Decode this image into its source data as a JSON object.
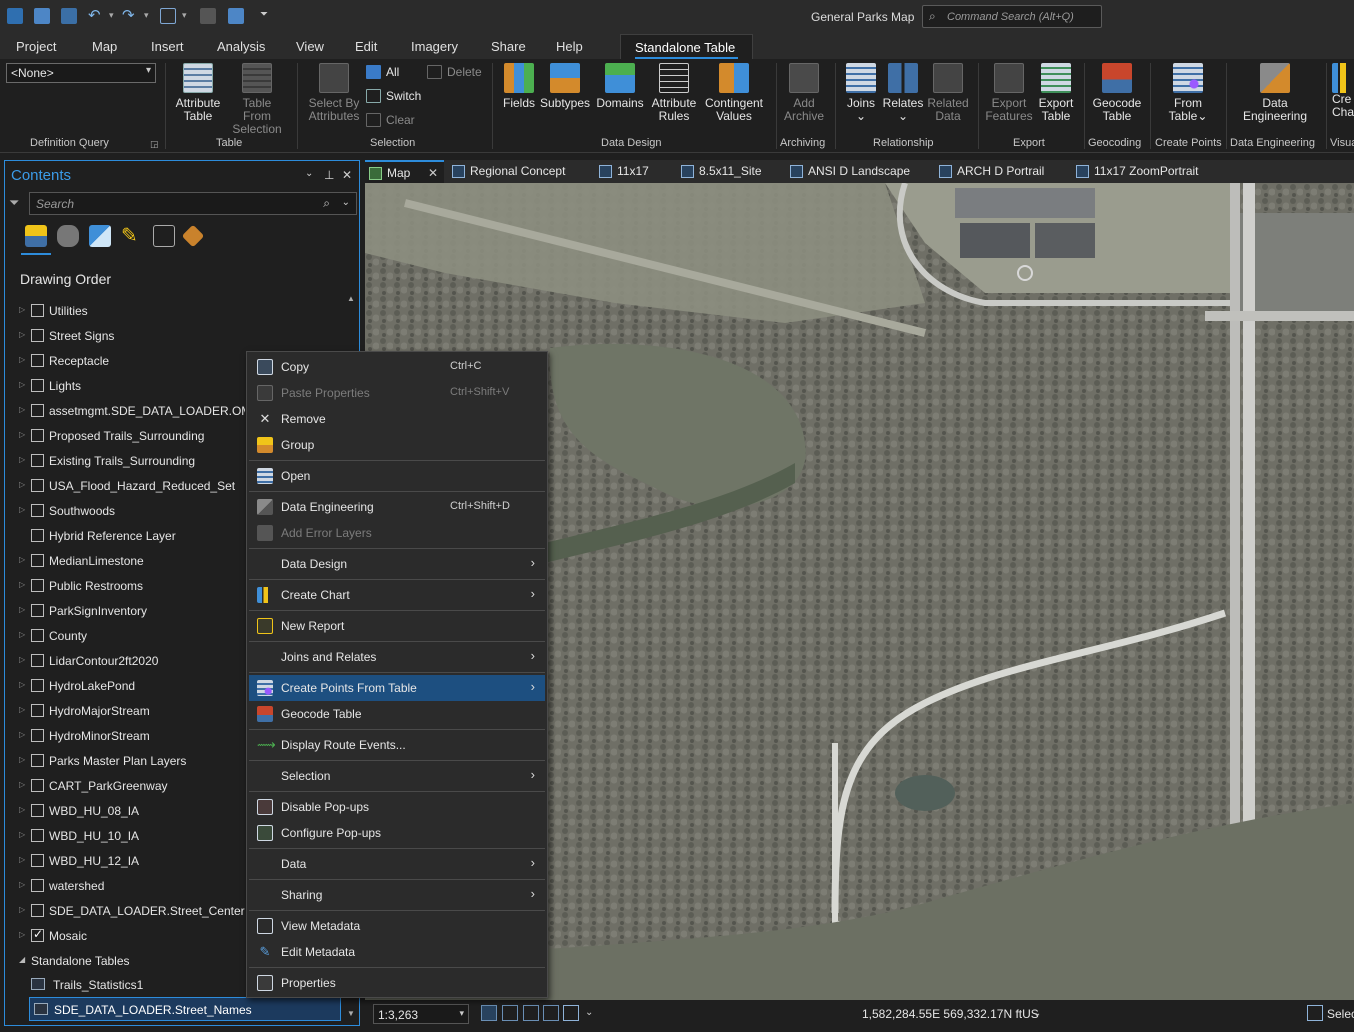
{
  "app": {
    "title": "General Parks Map",
    "command_search_placeholder": "Command Search (Alt+Q)"
  },
  "menu_tabs": [
    "Project",
    "Map",
    "Insert",
    "Analysis",
    "View",
    "Edit",
    "Imagery",
    "Share",
    "Help"
  ],
  "active_contextual_tab": "Standalone Table",
  "ribbon": {
    "definition_query_value": "<None>",
    "groups": {
      "definition_query": "Definition Query",
      "table": "Table",
      "selection": "Selection",
      "data_design": "Data Design",
      "archiving": "Archiving",
      "relationship": "Relationship",
      "export": "Export",
      "geocoding": "Geocoding",
      "create_points": "Create Points",
      "data_engineering": "Data Engineering",
      "visualize": "Visua"
    },
    "buttons": {
      "attribute_table": [
        "Attribute",
        "Table"
      ],
      "table_from_selection": [
        "Table From",
        "Selection"
      ],
      "select_by_attributes": [
        "Select By",
        "Attributes"
      ],
      "all": "All",
      "switch": "Switch",
      "clear": "Clear",
      "delete": "Delete",
      "fields": "Fields",
      "subtypes": "Subtypes",
      "domains": "Domains",
      "attribute_rules": [
        "Attribute",
        "Rules"
      ],
      "contingent_values": [
        "Contingent",
        "Values"
      ],
      "add_archive": [
        "Add",
        "Archive"
      ],
      "joins": "Joins",
      "relates": "Relates",
      "related_data": [
        "Related",
        "Data"
      ],
      "export_features": [
        "Export",
        "Features"
      ],
      "export_table": [
        "Export",
        "Table"
      ],
      "geocode_table": [
        "Geocode",
        "Table"
      ],
      "from_table": [
        "From",
        "Table"
      ],
      "data_engineering": [
        "Data",
        "Engineering"
      ],
      "create_chart": [
        "Cre",
        "Cha"
      ]
    }
  },
  "contents": {
    "title": "Contents",
    "search_placeholder": "Search",
    "section": "Drawing Order",
    "layers": [
      {
        "name": "Utilities",
        "checked": false,
        "expandable": true
      },
      {
        "name": "Street Signs",
        "checked": false,
        "expandable": true
      },
      {
        "name": "Receptacle",
        "checked": false,
        "expandable": true
      },
      {
        "name": "Lights",
        "checked": false,
        "expandable": true
      },
      {
        "name": "assetmgmt.SDE_DATA_LOADER.OM_F",
        "checked": false,
        "expandable": true
      },
      {
        "name": "Proposed Trails_Surrounding",
        "checked": false,
        "expandable": true
      },
      {
        "name": "Existing Trails_Surrounding",
        "checked": false,
        "expandable": true
      },
      {
        "name": "USA_Flood_Hazard_Reduced_Set",
        "checked": false,
        "expandable": true
      },
      {
        "name": "Southwoods",
        "checked": false,
        "expandable": true
      },
      {
        "name": "Hybrid Reference Layer",
        "checked": false,
        "expandable": false
      },
      {
        "name": "MedianLimestone",
        "checked": false,
        "expandable": true
      },
      {
        "name": "Public Restrooms",
        "checked": false,
        "expandable": true
      },
      {
        "name": "ParkSignInventory",
        "checked": false,
        "expandable": true
      },
      {
        "name": "County",
        "checked": false,
        "expandable": true
      },
      {
        "name": "LidarContour2ft2020",
        "checked": false,
        "expandable": true
      },
      {
        "name": "HydroLakePond",
        "checked": false,
        "expandable": true
      },
      {
        "name": "HydroMajorStream",
        "checked": false,
        "expandable": true
      },
      {
        "name": "HydroMinorStream",
        "checked": false,
        "expandable": true
      },
      {
        "name": "Parks Master Plan Layers",
        "checked": false,
        "expandable": true
      },
      {
        "name": "CART_ParkGreenway",
        "checked": false,
        "expandable": true
      },
      {
        "name": "WBD_HU_08_IA",
        "checked": false,
        "expandable": true
      },
      {
        "name": "WBD_HU_10_IA",
        "checked": false,
        "expandable": true
      },
      {
        "name": "WBD_HU_12_IA",
        "checked": false,
        "expandable": true
      },
      {
        "name": "watershed",
        "checked": false,
        "expandable": true
      },
      {
        "name": "SDE_DATA_LOADER.Street_Centerlines",
        "checked": false,
        "expandable": true
      },
      {
        "name": "Mosaic",
        "checked": true,
        "expandable": true
      }
    ],
    "standalone_tables_label": "Standalone Tables",
    "standalone_tables": [
      "Trails_Statistics1",
      "SDE_DATA_LOADER.Street_Names"
    ]
  },
  "map_tabs": [
    "Map",
    "Regional Concept",
    "11x17",
    "8.5x11_Site",
    "ANSI D Landscape",
    "ARCH D Portrail",
    "11x17 ZoomPortrait"
  ],
  "status": {
    "scale": "1:3,263",
    "coordinates": "1,582,284.55E 569,332.17N ftUS",
    "selection_label": "Selec"
  },
  "context_menu": [
    {
      "label": "Copy",
      "shortcut": "Ctrl+C",
      "icon": "copy-icon",
      "disabled": false,
      "submenu": false
    },
    {
      "label": "Paste Properties",
      "shortcut": "Ctrl+Shift+V",
      "icon": "paste-icon",
      "disabled": true,
      "submenu": false
    },
    {
      "label": "Remove",
      "shortcut": "",
      "icon": "remove-icon",
      "disabled": false,
      "submenu": false
    },
    {
      "label": "Group",
      "shortcut": "",
      "icon": "group-icon",
      "disabled": false,
      "submenu": false,
      "sep_after": true
    },
    {
      "label": "Open",
      "shortcut": "",
      "icon": "table-icon",
      "disabled": false,
      "submenu": false,
      "sep_after": true
    },
    {
      "label": "Data Engineering",
      "shortcut": "Ctrl+Shift+D",
      "icon": "data-engineering-icon",
      "disabled": false,
      "submenu": false
    },
    {
      "label": "Add Error Layers",
      "shortcut": "",
      "icon": "error-layers-icon",
      "disabled": true,
      "submenu": false,
      "sep_after": true
    },
    {
      "label": "Data Design",
      "shortcut": "",
      "icon": "",
      "disabled": false,
      "submenu": true,
      "sep_after": true
    },
    {
      "label": "Create Chart",
      "shortcut": "",
      "icon": "chart-icon",
      "disabled": false,
      "submenu": true,
      "sep_after": true
    },
    {
      "label": "New Report",
      "shortcut": "",
      "icon": "report-icon",
      "disabled": false,
      "submenu": false,
      "sep_after": true
    },
    {
      "label": "Joins and Relates",
      "shortcut": "",
      "icon": "",
      "disabled": false,
      "submenu": true,
      "sep_after": true
    },
    {
      "label": "Create Points From Table",
      "shortcut": "",
      "icon": "points-icon",
      "disabled": false,
      "submenu": true,
      "highlighted": true
    },
    {
      "label": "Geocode Table",
      "shortcut": "",
      "icon": "geocode-icon",
      "disabled": false,
      "submenu": false,
      "sep_after": true
    },
    {
      "label": "Display Route Events...",
      "shortcut": "",
      "icon": "route-icon",
      "disabled": false,
      "submenu": false,
      "sep_after": true
    },
    {
      "label": "Selection",
      "shortcut": "",
      "icon": "",
      "disabled": false,
      "submenu": true,
      "sep_after": true
    },
    {
      "label": "Disable Pop-ups",
      "shortcut": "",
      "icon": "popup-icon",
      "disabled": false,
      "submenu": false
    },
    {
      "label": "Configure Pop-ups",
      "shortcut": "",
      "icon": "configure-popup-icon",
      "disabled": false,
      "submenu": false,
      "sep_after": true
    },
    {
      "label": "Data",
      "shortcut": "",
      "icon": "",
      "disabled": false,
      "submenu": true,
      "sep_after": true
    },
    {
      "label": "Sharing",
      "shortcut": "",
      "icon": "",
      "disabled": false,
      "submenu": true,
      "sep_after": true
    },
    {
      "label": "View Metadata",
      "shortcut": "",
      "icon": "metadata-icon",
      "disabled": false,
      "submenu": false
    },
    {
      "label": "Edit Metadata",
      "shortcut": "",
      "icon": "edit-metadata-icon",
      "disabled": false,
      "submenu": false,
      "sep_after": true
    },
    {
      "label": "Properties",
      "shortcut": "",
      "icon": "properties-icon",
      "disabled": false,
      "submenu": false
    }
  ],
  "colors": {
    "accent": "#2d8cdb",
    "highlight": "#1d4f80",
    "panel": "#1f1f1f",
    "menu": "#2b2b2b"
  }
}
